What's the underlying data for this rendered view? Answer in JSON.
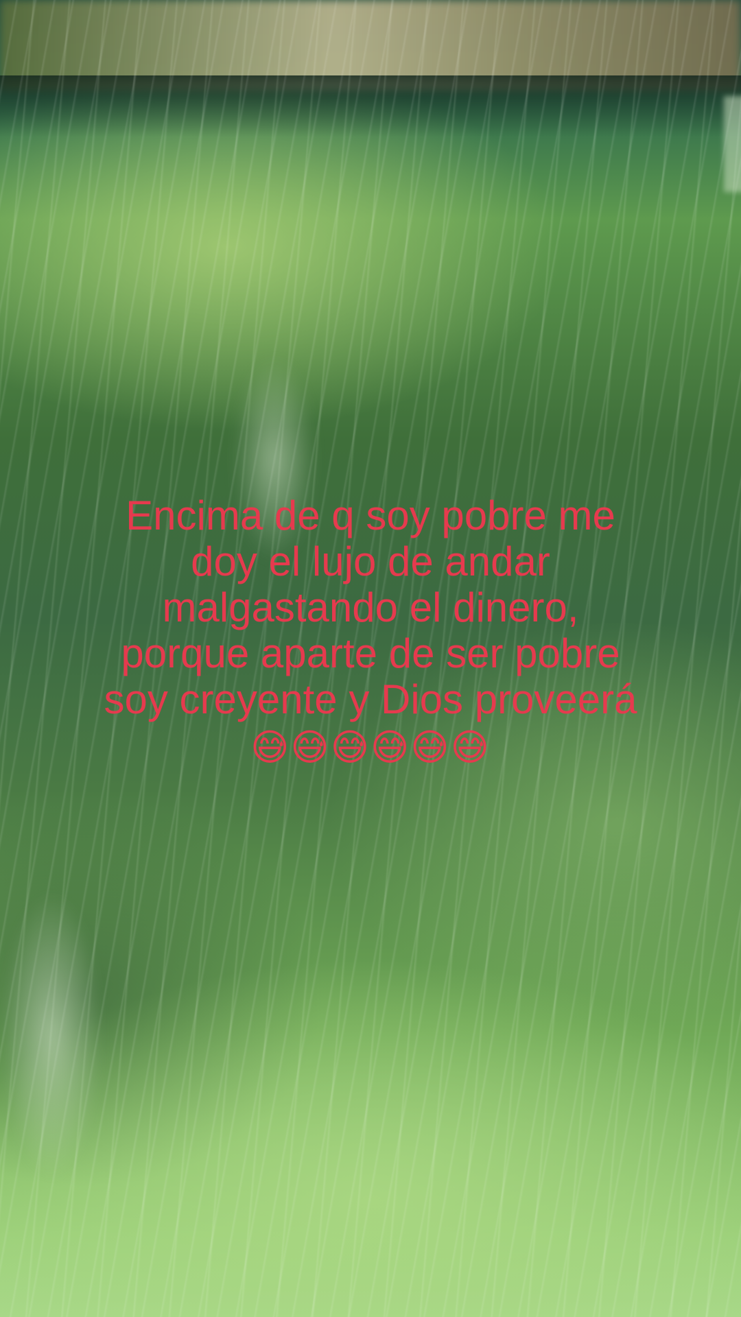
{
  "caption": {
    "lines": [
      "Encima de q soy pobre me",
      "doy el lujo de andar",
      "malgastando el dinero,",
      "porque aparte de ser pobre",
      "soy creyente y Dios proveerá"
    ],
    "emojis": "😅😅😅😅😅😅",
    "color": "#e63a4e"
  }
}
